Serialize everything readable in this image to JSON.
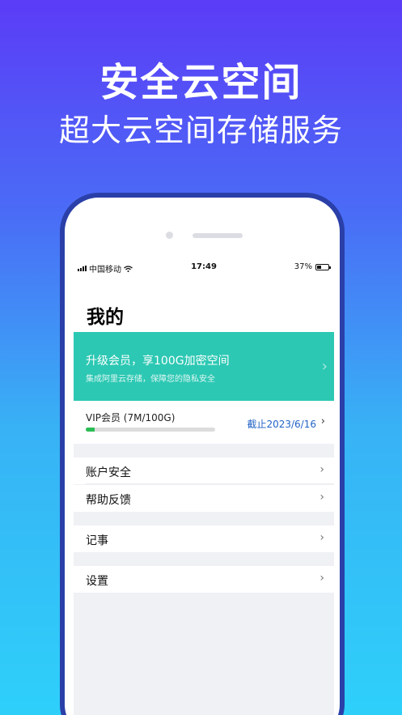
{
  "promo": {
    "headline": "安全云空间",
    "subheadline": "超大云空间存储服务"
  },
  "status_bar": {
    "carrier": "中国移动",
    "time": "17:49",
    "battery": "37%",
    "battery_level": 0.37
  },
  "page": {
    "title": "我的"
  },
  "upgrade_banner": {
    "title": "升级会员，享100G加密空间",
    "subtitle": "集成阿里云存储，保障您的隐私安全",
    "color": "#2cc8b3"
  },
  "vip": {
    "label": "VIP会员 (7M/100G)",
    "expiry": "截止2023/6/16",
    "usage_fraction": 0.07,
    "bar_color": "#2bbd55"
  },
  "menu": {
    "account_security": "账户安全",
    "help_feedback": "帮助反馈",
    "notes": "记事",
    "settings": "设置"
  },
  "icons": {
    "wifi": "wifi-icon",
    "signal": "signal-icon",
    "battery": "battery-icon",
    "chevron": "chevron-right-icon"
  }
}
